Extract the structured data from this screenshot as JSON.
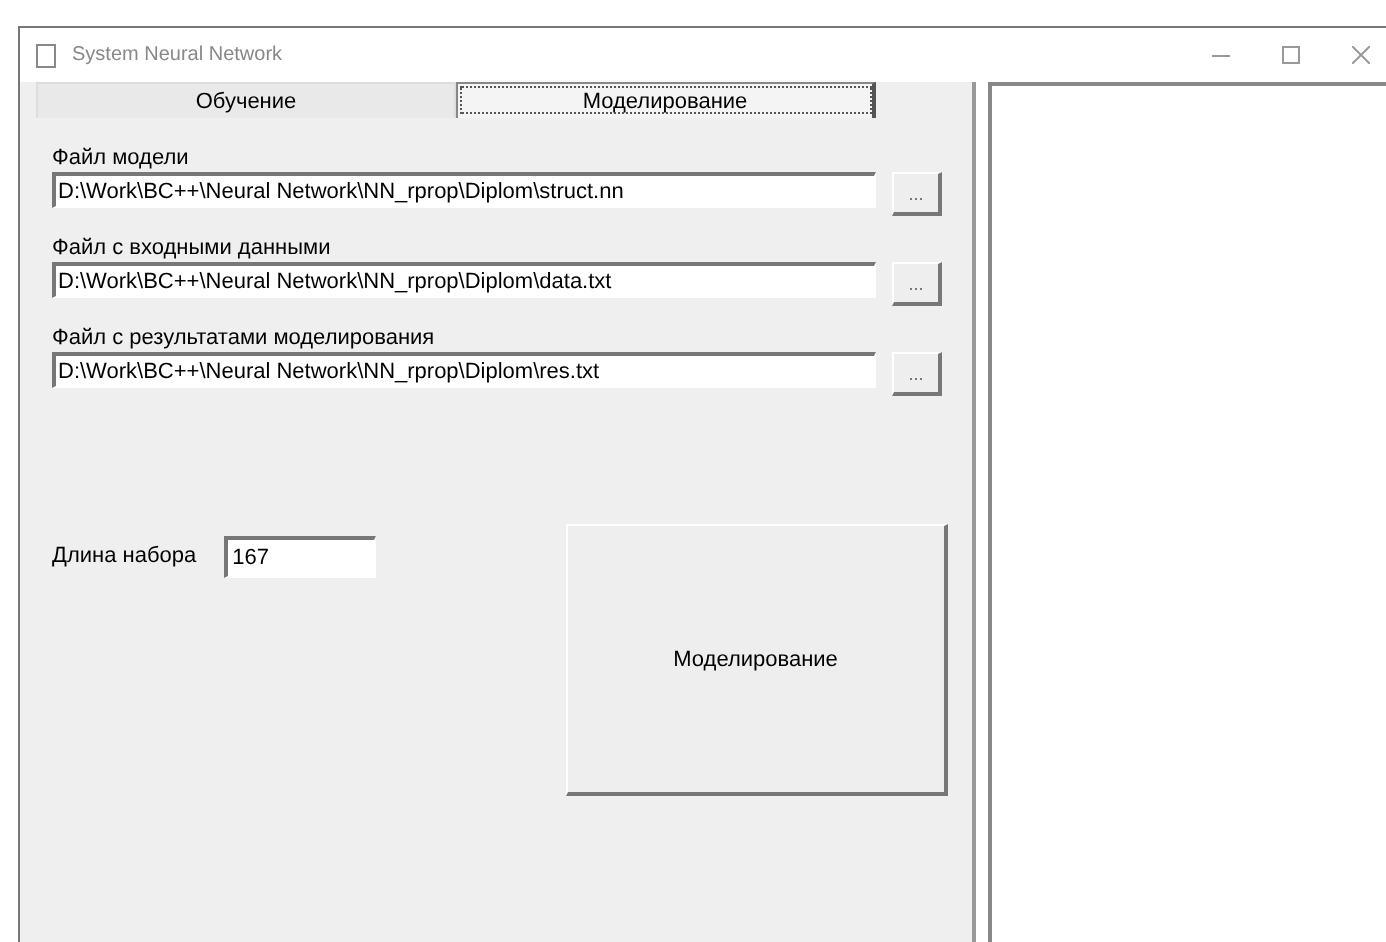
{
  "window": {
    "title": "System Neural Network"
  },
  "tabs": [
    {
      "label": "Обучение",
      "selected": false
    },
    {
      "label": "Моделирование",
      "selected": true
    }
  ],
  "file_fields": [
    {
      "label": "Файл модели",
      "value": "D:\\Work\\BC++\\Neural Network\\NN_rprop\\Diplom\\struct.nn",
      "browse": "..."
    },
    {
      "label": "Файл с входными данными",
      "value": "D:\\Work\\BC++\\Neural Network\\NN_rprop\\Diplom\\data.txt",
      "browse": "..."
    },
    {
      "label": "Файл с результатами моделирования",
      "value": "D:\\Work\\BC++\\Neural Network\\NN_rprop\\Diplom\\res.txt",
      "browse": "..."
    }
  ],
  "set_length": {
    "label": "Длина набора",
    "value": "167"
  },
  "run_button": {
    "label": "Моделирование"
  }
}
